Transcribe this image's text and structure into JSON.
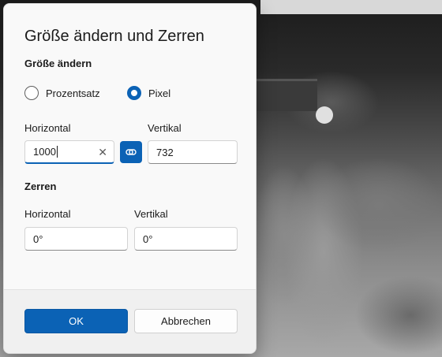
{
  "dialog": {
    "title": "Größe ändern und Zerren"
  },
  "resize": {
    "section_label": "Größe ändern",
    "options": [
      {
        "label": "Prozentsatz",
        "selected": false
      },
      {
        "label": "Pixel",
        "selected": true
      }
    ],
    "horizontal_label": "Horizontal",
    "vertical_label": "Vertikal",
    "horizontal_value": "1000",
    "vertical_value": "732",
    "lock_aspect_ratio": true
  },
  "skew": {
    "section_label": "Zerren",
    "horizontal_label": "Horizontal",
    "vertical_label": "Vertikal",
    "horizontal_value": "0°",
    "vertical_value": "0°"
  },
  "footer": {
    "ok_label": "OK",
    "cancel_label": "Abbrechen"
  },
  "icons": {
    "clear": "close-icon",
    "link": "link-icon"
  },
  "colors": {
    "accent": "#0b62b5",
    "dialog_bg": "#f9f9f9",
    "footer_bg": "#f0f0f0"
  }
}
